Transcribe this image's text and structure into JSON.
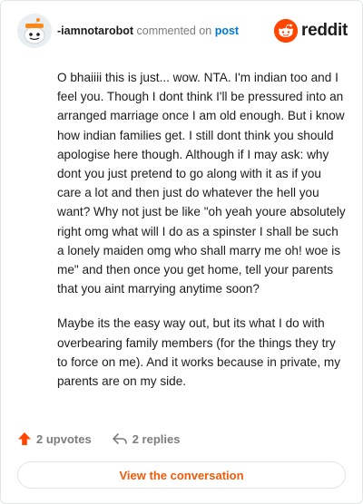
{
  "header": {
    "username": "-iamnotarobot",
    "commented_on": "commented on",
    "post_link": "post",
    "brand": "reddit",
    "avatar_icon": "snoo-avatar-icon",
    "brand_icon": "reddit-logo-icon"
  },
  "comment": {
    "paragraphs": [
      "O bhaiiii this is just... wow. NTA. I'm indian too and I feel you. Though I dont think I'll be pressured into an arranged marriage once I am old enough. But i know how indian families get. I still dont think you should apologise here though. Although if I may ask: why dont you just pretend to go along with it as if you care a lot and then just do whatever the hell you want? Why not just be like \"oh yeah youre absolutely right omg what will I do as a spinster I shall be such a lonely maiden omg who shall marry me oh! woe is me\" and then once you get home, tell your parents that you aint marrying anytime soon?",
      "Maybe its the easy way out, but its what I do with overbearing family members (for the things they try to force on me). And it works because in private, my parents are on my side."
    ]
  },
  "actions": {
    "upvotes": "2 upvotes",
    "replies": "2 replies",
    "upvote_icon": "upvote-arrow-icon",
    "reply_icon": "reply-arrow-icon"
  },
  "footer": {
    "view_button": "View the conversation"
  },
  "colors": {
    "accent": "#ff4500",
    "link": "#0079d3",
    "button_text": "#f05a0a",
    "muted": "#7c7c7c",
    "text": "#1c1c1c"
  }
}
